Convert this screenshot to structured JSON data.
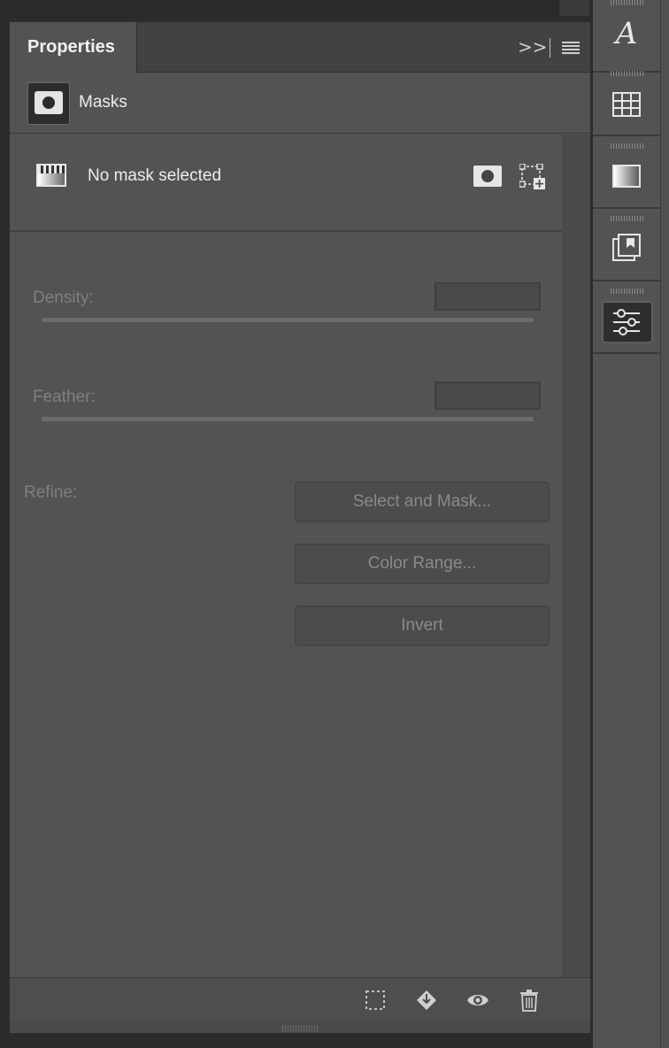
{
  "panel": {
    "tab_title": "Properties",
    "collapse_glyph": ">>",
    "section_title": "Masks",
    "mask_status": "No mask selected",
    "density": {
      "label": "Density:",
      "value": ""
    },
    "feather": {
      "label": "Feather:",
      "value": ""
    },
    "refine": {
      "label": "Refine:",
      "buttons": [
        "Select and Mask...",
        "Color Range...",
        "Invert"
      ]
    },
    "footer_icons": [
      "selection-from-mask-icon",
      "apply-mask-icon",
      "toggle-mask-visibility-icon",
      "delete-mask-icon"
    ]
  },
  "dock": {
    "items": [
      {
        "name": "character-panel-icon",
        "glyph": "A",
        "active": false
      },
      {
        "name": "swatches-grid-icon",
        "active": false
      },
      {
        "name": "gradients-icon",
        "active": false
      },
      {
        "name": "libraries-icon",
        "active": false
      },
      {
        "name": "properties-sliders-icon",
        "active": true
      }
    ]
  },
  "colors": {
    "panel_bg": "#535353",
    "tab_bg": "#424242",
    "text_primary": "#ececec",
    "text_disabled": "#7f7f7f"
  }
}
